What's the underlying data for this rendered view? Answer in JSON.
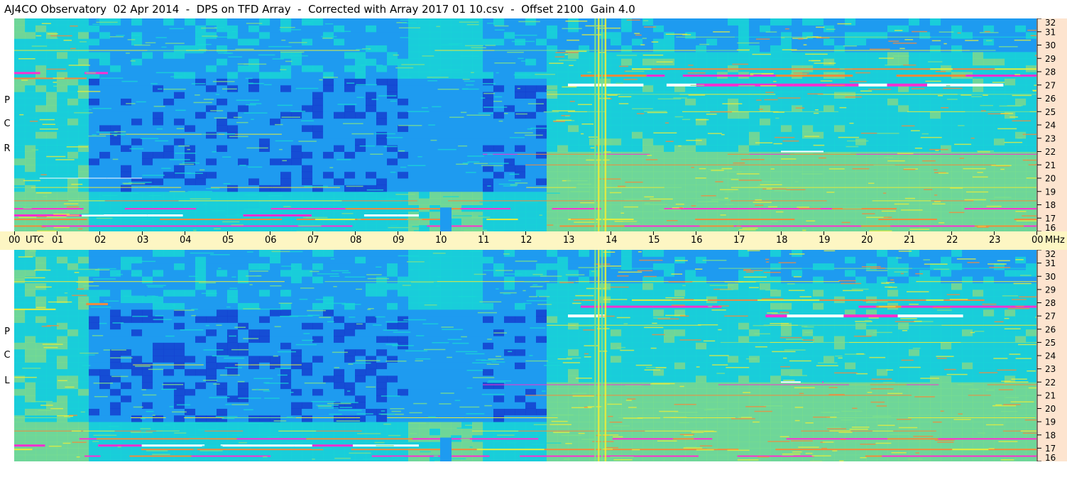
{
  "title": "AJ4CO Observatory  02 Apr 2014  -  DPS on TFD Array  -  Corrected with Array 2017 01 10.csv  -  Offset 2100  Gain 4.0",
  "chart_data": {
    "type": "heatmap",
    "x_axis": {
      "labels": [
        "00",
        "UTC",
        "01",
        "02",
        "03",
        "04",
        "05",
        "06",
        "07",
        "08",
        "09",
        "10",
        "11",
        "12",
        "13",
        "14",
        "15",
        "16",
        "17",
        "18",
        "19",
        "20",
        "21",
        "22",
        "23",
        "00",
        "MHz"
      ],
      "hour_ticks": [
        0,
        1,
        2,
        3,
        4,
        5,
        6,
        7,
        8,
        9,
        10,
        11,
        12,
        13,
        14,
        15,
        16,
        17,
        18,
        19,
        20,
        21,
        22,
        23,
        24
      ],
      "range": [
        0,
        24
      ]
    },
    "y_axis": {
      "range": [
        16,
        32
      ],
      "tick_labels": [
        "32",
        "31",
        "30",
        "29",
        "28",
        "27",
        "26",
        "25",
        "24",
        "23",
        "22",
        "21",
        "20",
        "19",
        "18",
        "17",
        "16"
      ]
    },
    "panels": [
      {
        "polarization": [
          "R",
          "C",
          "P"
        ]
      },
      {
        "polarization": [
          "L",
          "C",
          "P"
        ]
      }
    ],
    "colors": {
      "low": "#1440d0",
      "mid_low": "#1e9bf0",
      "mid": "#19d6d6",
      "mid_high": "#7de08a",
      "high": "#e6ec3c",
      "very_high": "#f28a3c",
      "peak": "#ff2fd0",
      "saturated": "#ffffff"
    }
  }
}
